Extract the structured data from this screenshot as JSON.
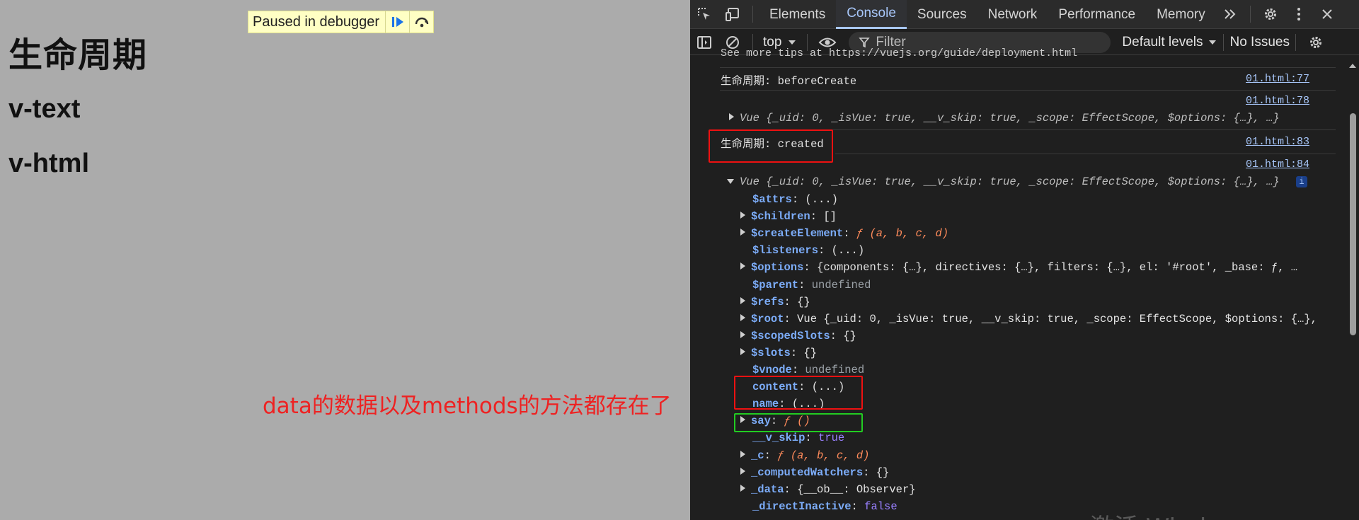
{
  "page": {
    "heading": "生命周期",
    "line1": "v-text",
    "line2": "v-html",
    "paused_label": "Paused in debugger",
    "annotation": "data的数据以及methods的方法都存在了"
  },
  "devtools": {
    "tabs": [
      "Elements",
      "Console",
      "Sources",
      "Network",
      "Performance",
      "Memory"
    ],
    "active_tab": "Console",
    "toolbar": {
      "context": "top",
      "filter_placeholder": "Filter",
      "levels": "Default levels",
      "issues": "No Issues"
    },
    "console": {
      "tip_line": "See more tips at https://vuejs.org/guide/deployment.html",
      "log1": {
        "text": "生命周期: beforeCreate",
        "source": "01.html:77"
      },
      "obj1": {
        "source": "01.html:78",
        "preview": "Vue  {_uid: 0, _isVue: true, __v_skip: true, _scope: EffectScope, $options: {…},  …}"
      },
      "log2": {
        "text": "生命周期: created",
        "source": "01.html:83"
      },
      "obj2": {
        "source": "01.html:84",
        "preview": "Vue  {_uid: 0, _isVue: true, __v_skip: true, _scope: EffectScope, $options: {…},  …}",
        "info_badge": "i"
      },
      "props": [
        {
          "key": "$attrs",
          "value": "(...)",
          "expandable": false
        },
        {
          "key": "$children",
          "value": "[]",
          "expandable": true
        },
        {
          "key": "$createElement",
          "value": "ƒ (a, b, c, d)",
          "expandable": true
        },
        {
          "key": "$listeners",
          "value": "(...)",
          "expandable": false
        },
        {
          "key": "$options",
          "value": "{components: {…}, directives: {…}, filters: {…}, el: '#root', _base: ƒ, …",
          "expandable": true
        },
        {
          "key": "$parent",
          "value": "undefined",
          "expandable": false
        },
        {
          "key": "$refs",
          "value": "{}",
          "expandable": true
        },
        {
          "key": "$root",
          "value": "Vue  {_uid: 0, _isVue: true, __v_skip: true, _scope: EffectScope, $options: {…},",
          "expandable": true
        },
        {
          "key": "$scopedSlots",
          "value": "{}",
          "expandable": true
        },
        {
          "key": "$slots",
          "value": "{}",
          "expandable": true
        },
        {
          "key": "$vnode",
          "value": "undefined",
          "expandable": false
        },
        {
          "key": "content",
          "value": "(...)",
          "expandable": false
        },
        {
          "key": "name",
          "value": "(...)",
          "expandable": false
        },
        {
          "key": "say",
          "value": "ƒ ()",
          "expandable": true
        },
        {
          "key": "__v_skip",
          "value": "true",
          "expandable": false
        },
        {
          "key": "_c",
          "value": "ƒ (a, b, c, d)",
          "expandable": true
        },
        {
          "key": "_computedWatchers",
          "value": "{}",
          "expandable": true
        },
        {
          "key": "_data",
          "value": "{__ob__: Observer}",
          "expandable": true
        },
        {
          "key": "_directInactive",
          "value": "false",
          "expandable": false
        }
      ]
    },
    "watermark": "激活 Windows"
  }
}
